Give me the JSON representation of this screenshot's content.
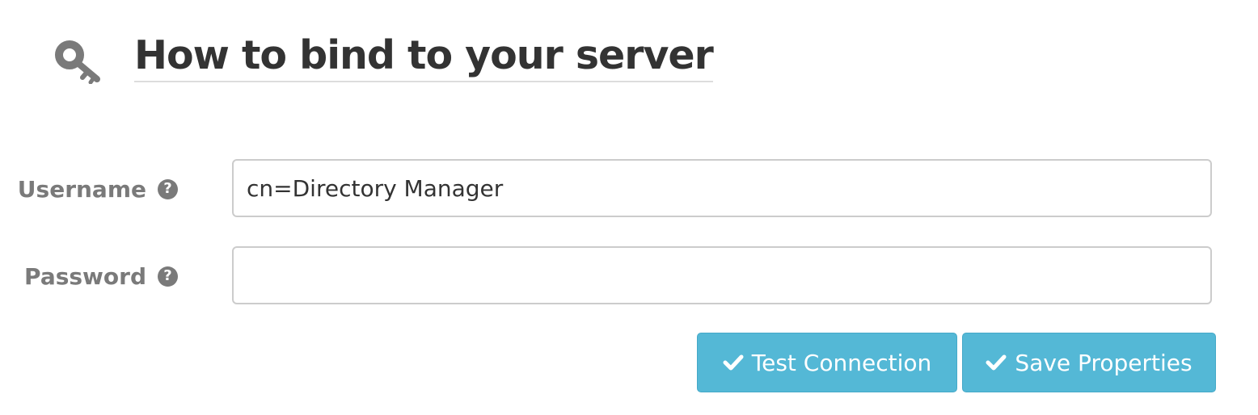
{
  "header": {
    "title": "How to bind to your server",
    "icon": "key-icon"
  },
  "form": {
    "username": {
      "label": "Username",
      "help_icon": "question-circle-icon",
      "help_glyph": "?",
      "value": "cn=Directory Manager",
      "placeholder": ""
    },
    "password": {
      "label": "Password",
      "help_icon": "question-circle-icon",
      "help_glyph": "?",
      "value": "",
      "placeholder": ""
    }
  },
  "actions": {
    "test_label": "Test Connection",
    "save_label": "Save Properties",
    "button_icon": "check-icon"
  },
  "colors": {
    "button": "#54b8d6",
    "label": "#7a7a7a",
    "title": "#333333"
  }
}
